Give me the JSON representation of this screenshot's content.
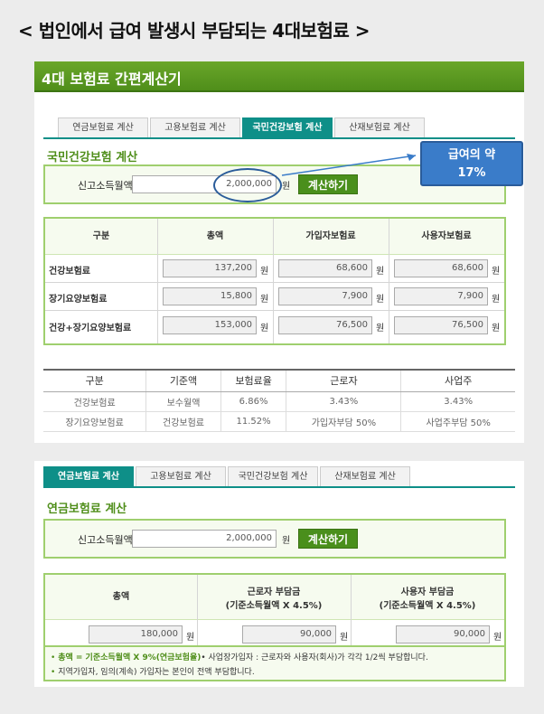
{
  "headline": "< 법인에서 급여 발생시 부담되는 4대보험료 >",
  "calculator": {
    "banner_title": "4대 보험료 간편계산기",
    "tabs": [
      "연금보험료 계산",
      "고용보험료 계산",
      "국민건강보험 계산",
      "산재보험료 계산"
    ]
  },
  "health": {
    "active_tab_index": 2,
    "section_title": "국민건강보험 계산",
    "income_label": "신고소득월액",
    "income_value": "2,000,000",
    "income_unit": "원",
    "calc_button": "계산하기",
    "headers": [
      "구분",
      "총액",
      "가입자보험료",
      "사용자보험료"
    ],
    "rows": [
      {
        "label": "건강보험료",
        "total": "137,200",
        "employee": "68,600",
        "employer": "68,600"
      },
      {
        "label": "장기요양보험료",
        "total": "15,800",
        "employee": "7,900",
        "employer": "7,900"
      },
      {
        "label": "건강+장기요양보험료",
        "total": "153,000",
        "employee": "76,500",
        "employer": "76,500"
      }
    ],
    "won": "원"
  },
  "rate_table": {
    "headers": [
      "구분",
      "기준액",
      "보험료율",
      "근로자",
      "사업주"
    ],
    "rows": [
      [
        "건강보험료",
        "보수월액",
        "6.86%",
        "3.43%",
        "3.43%"
      ],
      [
        "장기요양보험료",
        "건강보험료",
        "11.52%",
        "가입자부담 50%",
        "사업주부담 50%"
      ]
    ]
  },
  "callout": {
    "line1": "급여의 약",
    "line2": "17%",
    "color": "#3a7cc9"
  },
  "pension": {
    "active_tab_index": 0,
    "section_title": "연금보험료 계산",
    "income_label": "신고소득월액",
    "income_value": "2,000,000",
    "income_unit": "원",
    "calc_button": "계산하기",
    "headers": {
      "total": "총액",
      "employee_line1": "근로자 부담금",
      "employee_line2": "(기준소득월액 X 4.5%)",
      "employer_line1": "사용자 부담금",
      "employer_line2": "(기준소득월액 X 4.5%)"
    },
    "values": {
      "total": "180,000",
      "employee": "90,000",
      "employer": "90,000"
    },
    "won": "원",
    "note1_bold": "총액 = 기준소득월액 X 9%(연금보험율)",
    "note1_rest": "• 사업장가입자 : 근로자와 사용자(회사)가 각각 1/2씩 부담합니다.",
    "note2": "지역가입자, 임의(계속) 가입자는 본인이 전액 부담합니다."
  },
  "colors": {
    "accent_green": "#4f8e1a",
    "tab_teal": "#0e8f88"
  }
}
